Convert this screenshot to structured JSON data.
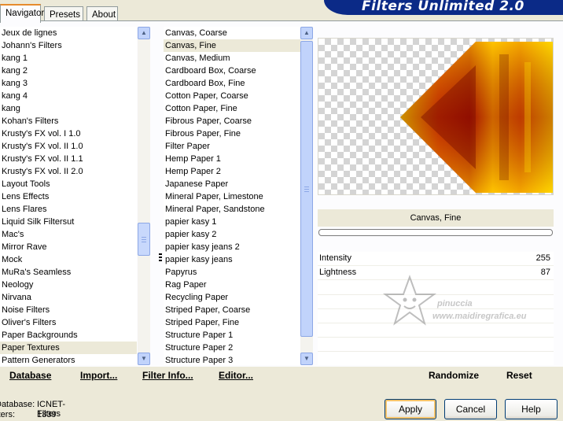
{
  "tabs": [
    {
      "label": "Navigator",
      "active": true
    },
    {
      "label": "Presets",
      "active": false
    },
    {
      "label": "About",
      "active": false
    }
  ],
  "banner": {
    "title": "Filters Unlimited 2.0",
    "color": "#0b2a87"
  },
  "categories": {
    "items": [
      "Jeux de lignes",
      "Johann's Filters",
      "kang 1",
      "kang 2",
      "kang 3",
      "kang 4",
      "kang",
      "Kohan's Filters",
      "Krusty's FX vol. I 1.0",
      "Krusty's FX vol. II 1.0",
      "Krusty's FX vol. II 1.1",
      "Krusty's FX vol. II 2.0",
      "Layout Tools",
      "Lens Effects",
      "Lens Flares",
      "Liquid Silk Filtersut",
      "Mac's",
      "Mirror Rave",
      "Mock",
      "MuRa's Seamless",
      "Neology",
      "Nirvana",
      "Noise Filters",
      "Oliver's Filters",
      "Paper Backgrounds",
      "Paper Textures",
      "Pattern Generators"
    ],
    "selected": "Paper Textures"
  },
  "filters": {
    "items": [
      "Canvas, Coarse",
      "Canvas, Fine",
      "Canvas, Medium",
      "Cardboard Box, Coarse",
      "Cardboard Box, Fine",
      "Cotton Paper, Coarse",
      "Cotton Paper, Fine",
      "Fibrous Paper, Coarse",
      "Fibrous Paper, Fine",
      "Filter Paper",
      "Hemp Paper 1",
      "Hemp Paper 2",
      "Japanese Paper",
      "Mineral Paper, Limestone",
      "Mineral Paper, Sandstone",
      "papier kasy 1",
      "papier kasy 2",
      "papier kasy jeans 2",
      "papier kasy jeans",
      "Papyrus",
      "Rag Paper",
      "Recycling Paper",
      "Striped Paper, Coarse",
      "Striped Paper, Fine",
      "Structure Paper 1",
      "Structure Paper 2",
      "Structure Paper 3"
    ],
    "selected": "Canvas, Fine"
  },
  "preview": {
    "filter_name": "Canvas, Fine"
  },
  "params": [
    {
      "name": "Intensity",
      "value": "255"
    },
    {
      "name": "Lightness",
      "value": "87"
    }
  ],
  "watermark": {
    "name": "pinuccia",
    "url": "www.maidiregrafica.eu"
  },
  "toolbar": {
    "database": "Database",
    "import": "Import...",
    "filter_info": "Filter Info...",
    "editor": "Editor...",
    "randomize": "Randomize",
    "reset": "Reset"
  },
  "status": {
    "database_label": "Database:",
    "database_value": "ICNET-Filters",
    "filters_label": "Filters:",
    "filters_value": "1339"
  },
  "buttons": {
    "apply": "Apply",
    "cancel": "Cancel",
    "help": "Help"
  },
  "icons": {
    "scroll_up": "scroll-up-arrow-icon",
    "scroll_down": "scroll-down-arrow-icon",
    "grip": "scroll-grip-icon"
  }
}
